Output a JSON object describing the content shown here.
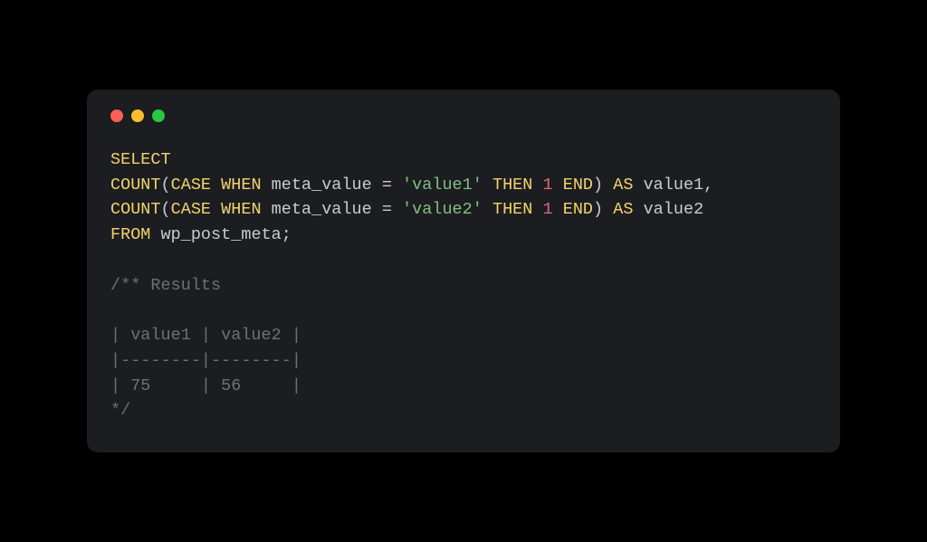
{
  "window": {
    "traffic_lights": [
      "close",
      "minimize",
      "zoom"
    ]
  },
  "code": {
    "line1": {
      "select": "SELECT"
    },
    "line2": {
      "count": "COUNT",
      "lparen": "(",
      "case": "CASE",
      "when": "WHEN",
      "ident": " meta_value ",
      "eq": "=",
      "sp": " ",
      "str": "'value1'",
      "sp2": " ",
      "then": "THEN",
      "sp3": " ",
      "num": "1",
      "sp4": " ",
      "end": "END",
      "rparen": ")",
      "sp5": " ",
      "as": "AS",
      "alias": " value1,"
    },
    "line3": {
      "count": "COUNT",
      "lparen": "(",
      "case": "CASE",
      "when": "WHEN",
      "ident": " meta_value ",
      "eq": "=",
      "sp": " ",
      "str": "'value2'",
      "sp2": " ",
      "then": "THEN",
      "sp3": " ",
      "num": "1",
      "sp4": " ",
      "end": "END",
      "rparen": ")",
      "sp5": " ",
      "as": "AS",
      "alias": " value2"
    },
    "line4": {
      "from": "FROM",
      "table": " wp_post_meta;"
    },
    "blank": "",
    "comment_open": "/** Results",
    "table_header": "| value1 | value2 |",
    "table_sep": "|--------|--------|",
    "table_row": "| 75     | 56     |",
    "comment_close": "*/"
  }
}
